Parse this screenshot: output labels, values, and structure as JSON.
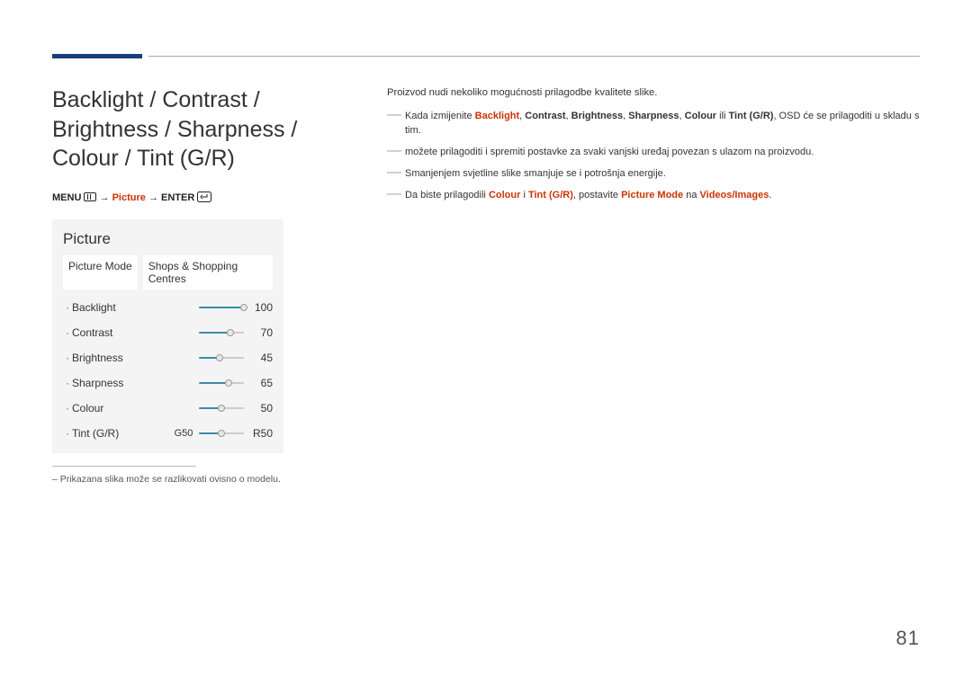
{
  "heading": "Backlight / Contrast / Brightness / Sharpness / Colour / Tint (G/R)",
  "breadcrumb": {
    "menu": "MENU",
    "picture": "Picture",
    "enter": "ENTER",
    "arrow": "→"
  },
  "panel": {
    "title": "Picture",
    "mode_label": "Picture Mode",
    "mode_value": "Shops & Shopping Centres",
    "items": [
      {
        "label": "Backlight",
        "value": "100",
        "pct": 100,
        "pre": "",
        "post": ""
      },
      {
        "label": "Contrast",
        "value": "70",
        "pct": 70,
        "pre": "",
        "post": ""
      },
      {
        "label": "Brightness",
        "value": "45",
        "pct": 45,
        "pre": "",
        "post": ""
      },
      {
        "label": "Sharpness",
        "value": "65",
        "pct": 65,
        "pre": "",
        "post": ""
      },
      {
        "label": "Colour",
        "value": "50",
        "pct": 50,
        "pre": "",
        "post": ""
      },
      {
        "label": "Tint (G/R)",
        "value": "R50",
        "pct": 50,
        "pre": "G50",
        "post": ""
      }
    ]
  },
  "footnote": "Prikazana slika može se razlikovati ovisno o modelu.",
  "intro": "Proizvod nudi nekoliko mogućnosti prilagodbe kvalitete slike.",
  "notes": {
    "n1a": "Kada izmijenite ",
    "n1_list": [
      "Backlight",
      "Contrast",
      "Brightness",
      "Sharpness",
      "Colour"
    ],
    "n1b": " ili ",
    "n1_last": "Tint (G/R)",
    "n1c": ", OSD će se prilagoditi u skladu s tim.",
    "n2": "možete prilagoditi i spremiti postavke za svaki vanjski uređaj povezan s ulazom na proizvodu.",
    "n3": "Smanjenjem svjetline slike smanjuje se i potrošnja energije.",
    "n4a": "Da biste prilagodili ",
    "n4_c": "Colour",
    "n4b": " i ",
    "n4_t": "Tint (G/R)",
    "n4c": ", postavite ",
    "n4_pm": "Picture Mode",
    "n4d": " na ",
    "n4_vi": "Videos/Images",
    "n4e": "."
  },
  "page": "81"
}
